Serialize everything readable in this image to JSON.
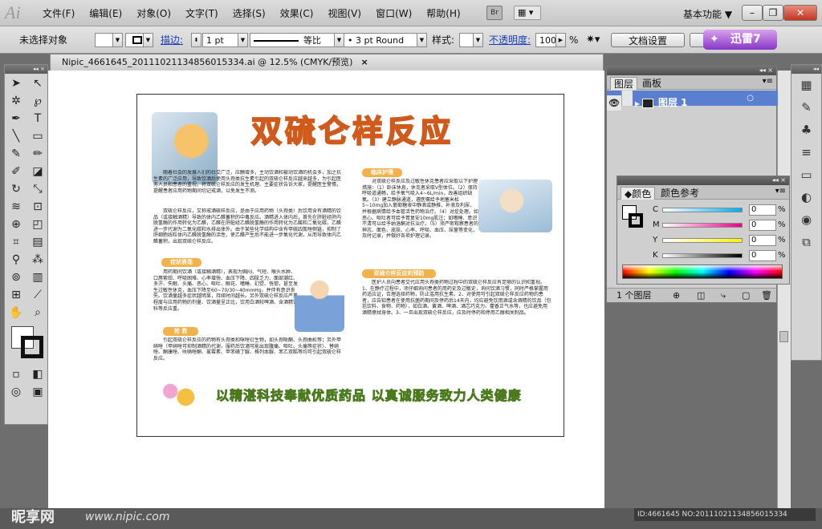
{
  "app": {
    "logo": "Ai"
  },
  "menus": [
    "文件(F)",
    "编辑(E)",
    "对象(O)",
    "文字(T)",
    "选择(S)",
    "效果(C)",
    "视图(V)",
    "窗口(W)",
    "帮助(H)"
  ],
  "topright": {
    "bridge_label": "Br",
    "arrange_icon": "layout-icon",
    "workspace": "基本功能 ▼",
    "minimize": "–",
    "restore": "❐",
    "close": "✕"
  },
  "control": {
    "selection": "未选择对象",
    "stroke_label": "描边:",
    "stroke_weight": "1 pt",
    "profile_label": "等比",
    "brush": "3 pt Round",
    "style_label": "样式:",
    "opacity_label": "不透明度:",
    "opacity_value": "100",
    "opacity_unit": "%",
    "doc_setup": "文档设置",
    "xunlei_label": "迅雷7"
  },
  "document": {
    "tab_title": "Nipic_4661645_20111021134856015334.ai @ 12.5% (CMYK/预览)",
    "close": "×"
  },
  "artwork": {
    "title": "双硫仑样反应",
    "sections": {
      "symptoms": "症状表现",
      "rescue": "抢 救",
      "care": "临床护理",
      "prevent": "双硫仑样反应的预防"
    },
    "slogan": "以精湛科技奉献优质药品  以真诚服务致力人类健康",
    "intro": "随着社会的发展人们的社交广泛，应酬增多，主动饮酒和被动饮酒的机会多，加之抗生素的广泛应用，导致饮酒后使用头孢类抗生素引起的双硫仑样反应越来越多，为引起医务人员和患者的重视，将双硫仑样反应的发生机理、主要症状告诉大家，提醒医生警惕，提醒患者应用药物期间切记戒酒，以免发生不测。",
    "mechanism": "双硫仑样反应，又称戒酒硫样反应，是由于应用药物（头孢类）后饮用含有酒精的饮品（或接触酒精）导致的体内乙醛蓄积的中毒反应。酒精进入体内后，首先在肝脏经肝内脱氢酶的作用转化为乙醛，乙醛在肝脏经乙醛脱氢酶的作用转化为乙酸和二氧化碳，乙醛进一步代谢为二氧化碳和水排出体外。由于某些化学结构中含有甲硫四氮唑侧链，抑制了肝细胞线粒体内乙醛脱氢酶的活性，使乙醛产生后不能进一步氧化代谢，从而导致体内乙醛蓄积，出现双硫仑样反应。",
    "symptoms": "用药期间饮酒（或接触酒精），表现为胸闷、气短、喉头水肿、口唇紫绀、呼吸困难、心率增快、血压下降、四肢乏力、面部潮红、多汗、失眠、头痛、恶心、呕吐、眼花、嗜睡、幻觉、恍惚，甚至发生过敏性休克，血压下降至60~70/30~40mmHg，并伴有意识丧失。饮酒量越多症状越明显，持续时间越长。另外双硫仑样反应严重程度与应用药物的剂量、饮酒量呈正比，饮用白酒较啤酒、含酒精饮料等反应重。",
    "rescue": "引起双硫仑样反应的药物有头孢类和咪唑衍生物，如头孢哌酮、头孢曲松等；另外甲硝唑（甲硝唑可抑制酒精的代谢，服药后饮酒可能出现腹痛、呕吐、头痛等症状）、替硝唑、酮康唑、呋喃唑酮、氯霉素、甲苯磺丁脲、格列本脲、苯乙双胍等均可引起双硫仑样反应。",
    "care": "对双硫仑样反应及过敏性休克患者应采取以下护理措施：（1）卧床休息，休克者采取V型体位。（2）保持呼吸道通畅，给予氧气吸入4~6L/min，改善组织缺氧。（3）建立静脉通道，遵医嘱给予地塞米松5~10mg加入葡萄糖液中静滴或静推，补液及利尿，并根据病情给予血管活性药物治疗。（4）对症处理。如恶心、呕吐者可给予胃复安10mg肌注；如嗜睡、意识不清可以给予纳洛酮对抗治疗。（5）须严密观察患者的神志、面色、皮肤、心率、呼吸、血压、尿量等变化，及时记录，并做好各项护理记录。",
    "prevent": "医护人员向患者交代应用头孢类药物过程中的双硫仑样反应有足够的认识和重视。1、在静疗过程中，须仔细询问患者的用药史及过敏史，询问饮酒习惯，同时严格掌握用药适应证，合理选择药物，防止滥用抗生素。2、对使用可引起双硫仑样反应药物的患者，应告知患者在使用抗菌药期间及停药后14天内，均应避免饮用酒或含酒精的饮品（包括饮料、食物、药物），如白酒、黄酒、啤酒、酒芯巧克力、藿香正气水等，也应避免用酒精擦拭身体。3、一旦出现双硫仑样反应，应及时停药和停用乙醇相关制品。"
  },
  "panels": {
    "layers": {
      "tab1": "图层",
      "tab2": "画板",
      "layer_name": "图层 1",
      "count": "1 个图层"
    },
    "color": {
      "tab1": "颜色",
      "tab2": "颜色参考",
      "channels": [
        {
          "label": "C",
          "value": "0",
          "unit": "%",
          "gradient": "linear-gradient(90deg,#fff,#00aeef)"
        },
        {
          "label": "M",
          "value": "0",
          "unit": "%",
          "gradient": "linear-gradient(90deg,#fff,#ec008c)"
        },
        {
          "label": "Y",
          "value": "0",
          "unit": "%",
          "gradient": "linear-gradient(90deg,#fff,#fff200)"
        },
        {
          "label": "K",
          "value": "0",
          "unit": "%",
          "gradient": "linear-gradient(90deg,#fff,#000)"
        }
      ]
    }
  },
  "watermark": {
    "brand": "昵享网",
    "url": "www.nipic.com",
    "id": "ID:4661645 NO:20111021134856015334"
  }
}
